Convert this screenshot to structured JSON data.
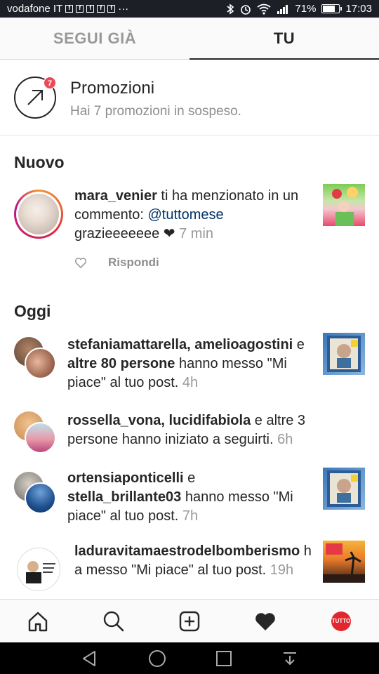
{
  "status_bar": {
    "carrier": "vodafone IT",
    "notif_glyph": "f",
    "more": "···",
    "battery": "71%",
    "battery_level": 0.71,
    "time": "17:03"
  },
  "tabs": [
    {
      "label": "SEGUI GIÀ",
      "active": false
    },
    {
      "label": "TU",
      "active": true
    }
  ],
  "promo": {
    "badge": "7",
    "title": "Promozioni",
    "subtitle": "Hai 7 promozioni in sospeso."
  },
  "sections": {
    "new_title": "Nuovo",
    "today_title": "Oggi"
  },
  "new_notification": {
    "user": "mara_venier",
    "text1": " ti ha menzionato in un commento: ",
    "mention": "@tuttomese",
    "comment": "grazieeeeeee ",
    "heart": "❤",
    "time": "7 min",
    "reply_label": "Rispondi"
  },
  "notifications": [
    {
      "users": "stefaniamattarella, amelioagostini",
      "conj": " e ",
      "others": "altre 80 persone",
      "action": " hanno messo \"Mi piace\" al tuo post. ",
      "time": "4h"
    },
    {
      "users": "rossella_vona, lucidifabiola",
      "action": " e altre 3 persone hanno iniziato a seguirti. ",
      "time": "6h"
    },
    {
      "user1": "ortensiaponticelli",
      "conj": " e ",
      "user2": "stella_brillante03",
      "action": " hanno messo \"Mi piace\" al tuo post. ",
      "time": "7h"
    },
    {
      "user": "laduravitamaestrodelbomberismo",
      "action": " ha messo \"Mi piace\" al tuo post. ",
      "time": "19h"
    }
  ],
  "bottom_nav": [
    "home-icon",
    "search-icon",
    "add-post-icon",
    "activity-heart-icon",
    "profile-avatar"
  ],
  "profile_logo_text": "TUTTO",
  "colors": {
    "accent_red": "#ed4956",
    "mention_blue": "#003569",
    "muted": "#8e8e8e"
  }
}
